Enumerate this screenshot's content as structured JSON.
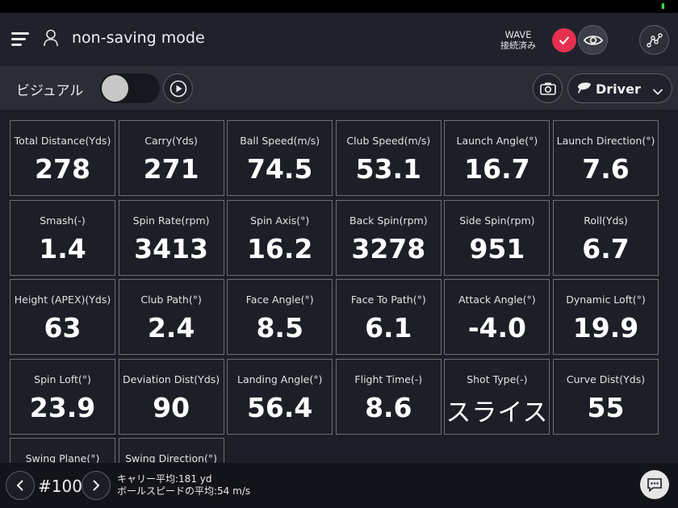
{
  "header": {
    "title": "non-saving mode",
    "wave_label": "WAVE",
    "wave_status": "接続済み"
  },
  "toolbar": {
    "visual_label": "ビジュアル",
    "club": "Driver",
    "toggle_on": false
  },
  "metrics": [
    {
      "label": "Total Distance(Yds)",
      "value": "278"
    },
    {
      "label": "Carry(Yds)",
      "value": "271"
    },
    {
      "label": "Ball Speed(m/s)",
      "value": "74.5"
    },
    {
      "label": "Club Speed(m/s)",
      "value": "53.1"
    },
    {
      "label": "Launch Angle(°)",
      "value": "16.7"
    },
    {
      "label": "Launch Direction(°)",
      "value": "7.6"
    },
    {
      "label": "Smash(-)",
      "value": "1.4"
    },
    {
      "label": "Spin Rate(rpm)",
      "value": "3413"
    },
    {
      "label": "Spin Axis(°)",
      "value": "16.2"
    },
    {
      "label": "Back Spin(rpm)",
      "value": "3278"
    },
    {
      "label": "Side Spin(rpm)",
      "value": "951"
    },
    {
      "label": "Roll(Yds)",
      "value": "6.7"
    },
    {
      "label": "Height (APEX)(Yds)",
      "value": "63"
    },
    {
      "label": "Club Path(°)",
      "value": "2.4"
    },
    {
      "label": "Face Angle(°)",
      "value": "8.5"
    },
    {
      "label": "Face To Path(°)",
      "value": "6.1"
    },
    {
      "label": "Attack Angle(°)",
      "value": "-4.0"
    },
    {
      "label": "Dynamic Loft(°)",
      "value": "19.9"
    },
    {
      "label": "Spin Loft(°)",
      "value": "23.9"
    },
    {
      "label": "Deviation Dist(Yds)",
      "value": "90"
    },
    {
      "label": "Landing Angle(°)",
      "value": "56.4"
    },
    {
      "label": "Flight Time(-)",
      "value": "8.6"
    },
    {
      "label": "Shot Type(-)",
      "value": "スライス"
    },
    {
      "label": "Curve Dist(Yds)",
      "value": "55"
    },
    {
      "label": "Swing Plane(°)",
      "value": ""
    },
    {
      "label": "Swing Direction(°)",
      "value": ""
    }
  ],
  "footer": {
    "shot_number": "#100",
    "carry_avg": "キャリー平均:181 yd",
    "ball_speed_avg": "ボールスピードの平均:54 m/s"
  },
  "colors": {
    "accent_red": "#e3314f",
    "tile_border": "#6a6e78",
    "background": "#1b1e26"
  },
  "icons": [
    "menu-icon",
    "user-icon",
    "check-icon",
    "eye-icon",
    "graph-icon",
    "play-icon",
    "camera-icon",
    "driver-icon",
    "chevron-down-icon",
    "chevron-left-icon",
    "chevron-right-icon",
    "chat-icon"
  ]
}
